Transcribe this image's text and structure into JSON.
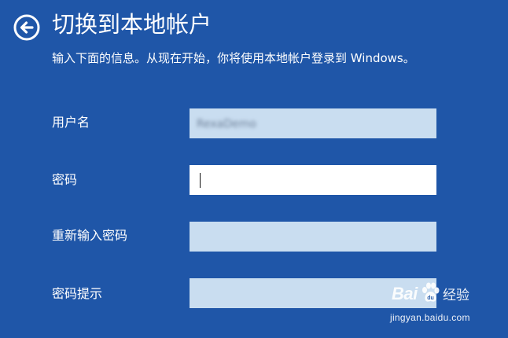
{
  "header": {
    "back_icon": "arrow-left-circle-icon",
    "title": "切换到本地帐户",
    "subtitle": "输入下面的信息。从现在开始，你将使用本地帐户登录到 Windows。"
  },
  "form": {
    "username": {
      "label": "用户名",
      "value": "RexaDemo"
    },
    "password": {
      "label": "密码",
      "value": ""
    },
    "confirm_password": {
      "label": "重新输入密码",
      "value": ""
    },
    "password_hint": {
      "label": "密码提示",
      "value": ""
    }
  },
  "watermark": {
    "brand": "Bai",
    "service": "经验",
    "url": "jingyan.baidu.com"
  },
  "colors": {
    "background": "#1f56a8",
    "input_inactive": "#c9ddf0",
    "input_active": "#ffffff",
    "text": "#ffffff"
  }
}
